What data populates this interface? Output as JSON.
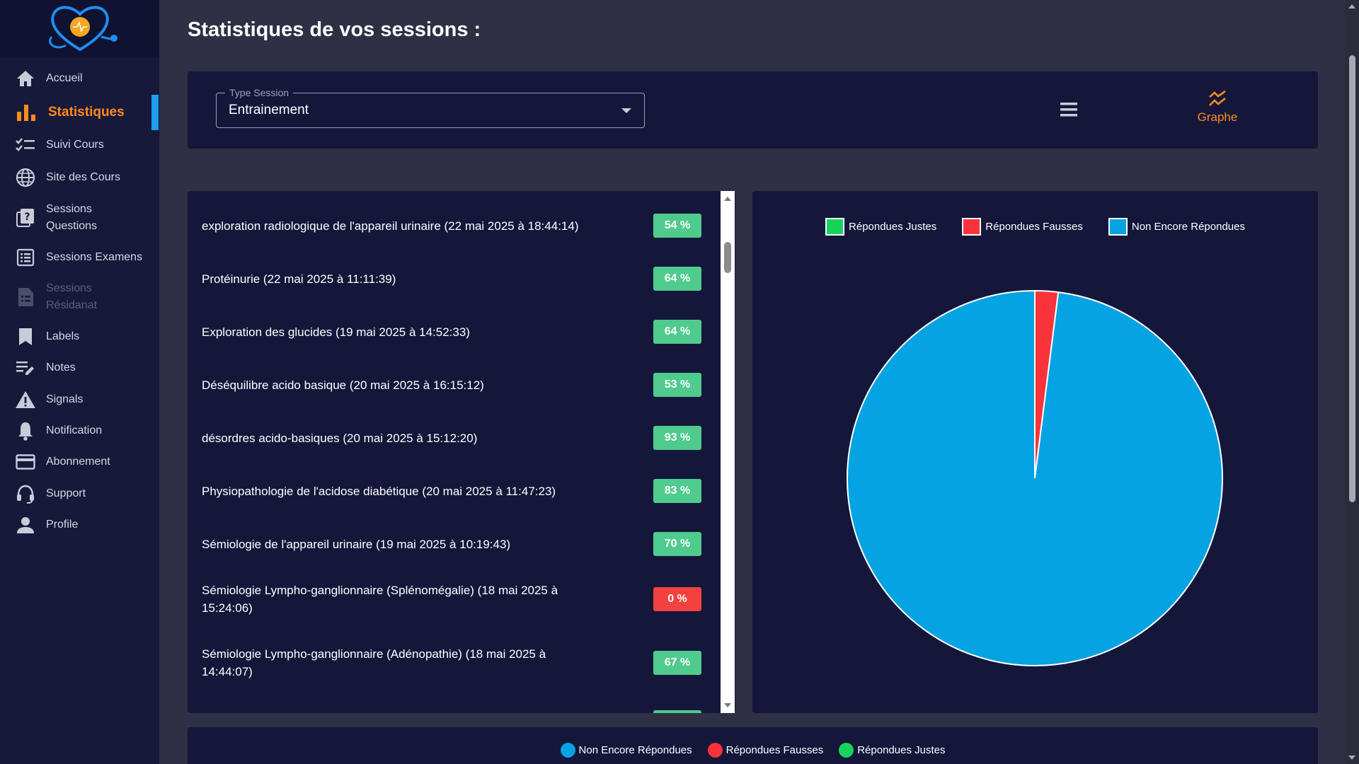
{
  "page_title": "Statistiques de vos sessions :",
  "sidebar": {
    "items": [
      {
        "label": "Accueil",
        "icon": "home-icon",
        "state": "normal"
      },
      {
        "label": "Statistiques",
        "icon": "bar-chart-icon",
        "state": "active"
      },
      {
        "label": "Suivi Cours",
        "icon": "checklist-icon",
        "state": "normal"
      },
      {
        "label": "Site des Cours",
        "icon": "globe-icon",
        "state": "normal"
      },
      {
        "label": "Sessions Questions",
        "icon": "question-book-icon",
        "state": "normal"
      },
      {
        "label": "Sessions Examens",
        "icon": "list-alt-icon",
        "state": "normal"
      },
      {
        "label": "Sessions Résidanat",
        "icon": "document-icon",
        "state": "disabled"
      },
      {
        "label": "Labels",
        "icon": "bookmark-icon",
        "state": "normal"
      },
      {
        "label": "Notes",
        "icon": "edit-note-icon",
        "state": "normal"
      },
      {
        "label": "Signals",
        "icon": "warning-icon",
        "state": "normal"
      },
      {
        "label": "Notification",
        "icon": "bell-icon",
        "state": "normal"
      },
      {
        "label": "Abonnement",
        "icon": "credit-card-icon",
        "state": "normal"
      },
      {
        "label": "Support",
        "icon": "headset-icon",
        "state": "normal"
      },
      {
        "label": "Profile",
        "icon": "person-icon",
        "state": "normal"
      }
    ]
  },
  "filter": {
    "select_label": "Type Session",
    "select_value": "Entrainement",
    "graph_label": "Graphe"
  },
  "sessions": [
    {
      "name": "exploration radiologique de l'appareil urinaire (22 mai 2025 à 18:44:14)",
      "score": "54 %",
      "status": "green"
    },
    {
      "name": "Protéinurie (22 mai 2025 à 11:11:39)",
      "score": "64 %",
      "status": "green"
    },
    {
      "name": "Exploration des glucides (19 mai 2025 à 14:52:33)",
      "score": "64 %",
      "status": "green"
    },
    {
      "name": "Déséquilibre acido basique (20 mai 2025 à 16:15:12)",
      "score": "53 %",
      "status": "green"
    },
    {
      "name": "désordres acido-basiques (20 mai 2025 à 15:12:20)",
      "score": "93 %",
      "status": "green"
    },
    {
      "name": "Physiopathologie de l'acidose diabétique (20 mai 2025 à 11:47:23)",
      "score": "83 %",
      "status": "green"
    },
    {
      "name": "Sémiologie de l'appareil urinaire (19 mai 2025 à 10:19:43)",
      "score": "70 %",
      "status": "green"
    },
    {
      "name": "Sémiologie Lympho-ganglionnaire (Splénomégalie) (18 mai 2025 à 15:24:06)",
      "score": "0 %",
      "status": "red"
    },
    {
      "name": "Sémiologie Lympho-ganglionnaire (Adénopathie) (18 mai 2025 à 14:44:07)",
      "score": "67 %",
      "status": "green"
    }
  ],
  "colors": {
    "justes": "#18d35a",
    "fausses": "#f8333c",
    "non_repondues": "#06a3e2",
    "accent": "#ff8a1e",
    "badge_green": "#4fcb8e",
    "badge_red": "#f2413f"
  },
  "chart_data": {
    "type": "pie",
    "legend": [
      "Répondues Justes",
      "Répondues Fausses",
      "Non Encore Répondues"
    ],
    "legend_position": "top",
    "slices": [
      {
        "label": "Répondues Justes",
        "value": 0
      },
      {
        "label": "Répondues Fausses",
        "value": 2
      },
      {
        "label": "Non Encore Répondues",
        "value": 98
      }
    ]
  },
  "bottom_legend": [
    "Non Encore Répondues",
    "Répondues Fausses",
    "Répondues Justes"
  ]
}
